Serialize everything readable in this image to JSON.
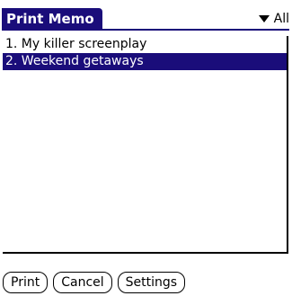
{
  "header": {
    "title": "Print Memo",
    "category": "All"
  },
  "list": {
    "items": [
      {
        "label": "1. My killer screenplay",
        "selected": false
      },
      {
        "label": "2. Weekend getaways",
        "selected": true
      }
    ]
  },
  "buttons": {
    "print": "Print",
    "cancel": "Cancel",
    "settings": "Settings"
  },
  "colors": {
    "accent": "#1a0d7a",
    "background": "#ffffff",
    "text": "#000000"
  }
}
